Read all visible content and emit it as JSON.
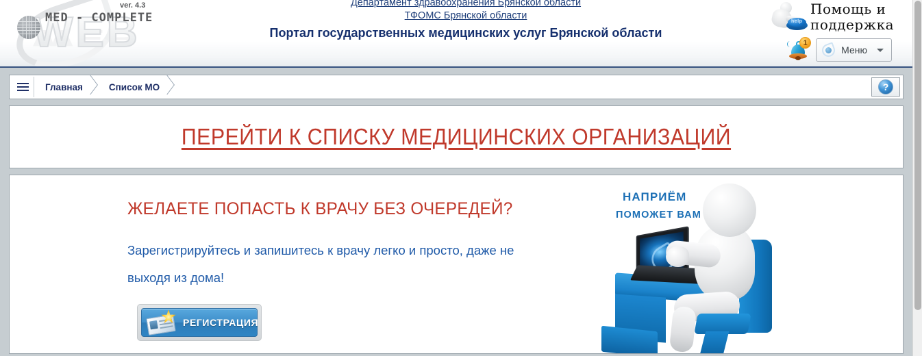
{
  "header": {
    "logo": {
      "version": "ver. 4.3",
      "title": "MED - COMPLETE",
      "wordmark": "WEB"
    },
    "org_titles": {
      "line1": "Департамент здравоохранения Брянской области",
      "line2": "ТФОМС Брянской области",
      "line3": "Портал государственных медицинских услуг Брянской области"
    },
    "help": {
      "label": "Помощь  и\nподдержка",
      "button_glyph": "help"
    },
    "notifications": {
      "count": "1"
    },
    "menu": {
      "label": "Меню"
    }
  },
  "breadcrumb": {
    "items": [
      {
        "label": "Главная"
      },
      {
        "label": "Список МО"
      }
    ],
    "help_button_glyph": "?"
  },
  "mo_panel": {
    "link_text": "ПЕРЕЙТИ К СПИСКУ МЕДИЦИНСКИХ ОРГАНИЗАЦИЙ"
  },
  "promo": {
    "heading": "ЖЕЛАЕТЕ ПОПАСТЬ К ВРАЧУ БЕЗ ОЧЕРЕДЕЙ?",
    "subtext": "Зарегистрируйтесь и запишитесь к врачу легко и просто, даже не выходя из дома!",
    "register_label": "РЕГИСТРАЦИЯ",
    "illustration": {
      "line1": "НАПРИЁМ",
      "line2": "ПОМОЖЕТ ВАМ"
    }
  },
  "colors": {
    "brand_blue": "#16306e",
    "link_blue": "#1f3f7a",
    "accent_red": "#c0392b",
    "promo_blue": "#1f5aa8",
    "illustration_blue": "#1b6fb5",
    "page_background": "#c6cdd1",
    "header_rule": "#36527f"
  }
}
